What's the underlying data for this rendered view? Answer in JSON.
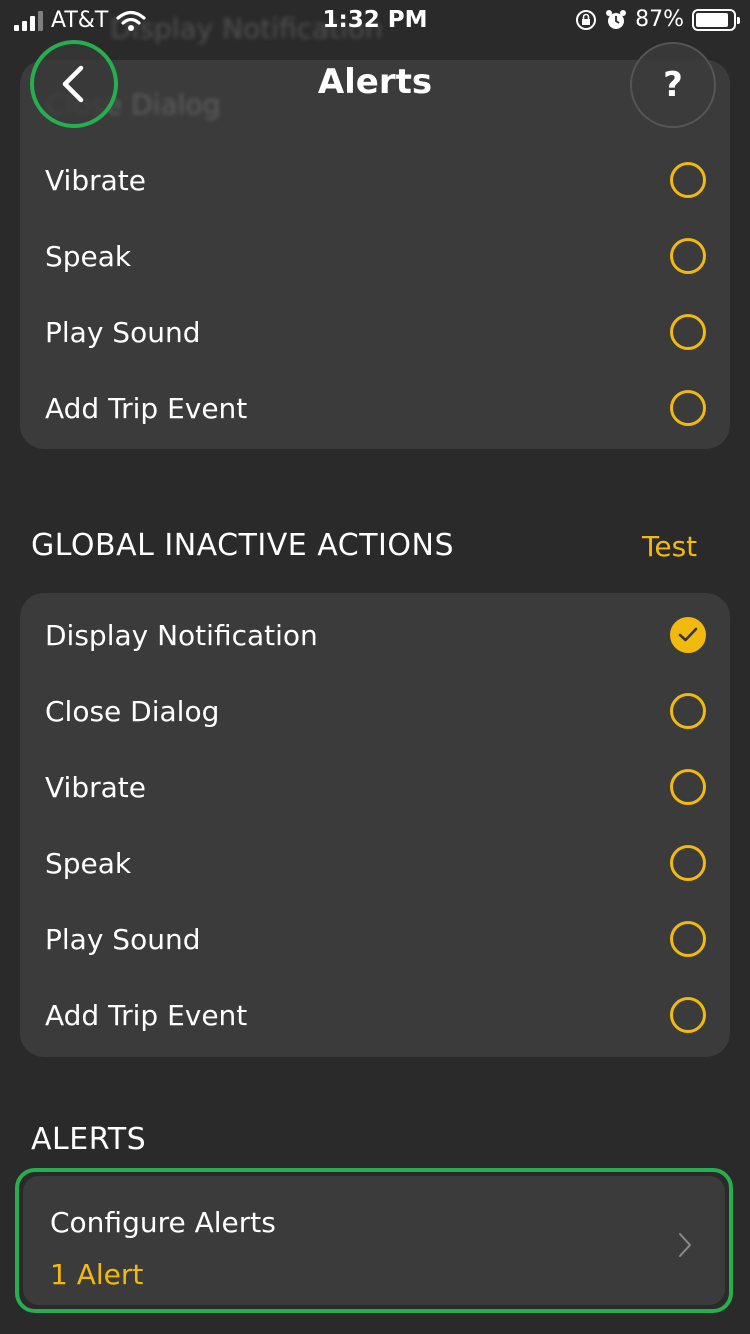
{
  "status_bar": {
    "carrier": "AT&T",
    "time": "1:32 PM",
    "battery": "87%"
  },
  "header": {
    "title": "Alerts",
    "help_label": "?",
    "ghost_line_1": "Display Notification",
    "ghost_line_2": "Close Dialog"
  },
  "global_active_partial": {
    "items": [
      {
        "label": "Vibrate",
        "checked": false
      },
      {
        "label": "Speak",
        "checked": false
      },
      {
        "label": "Play Sound",
        "checked": false
      },
      {
        "label": "Add Trip Event",
        "checked": false
      }
    ]
  },
  "global_inactive": {
    "title": "GLOBAL INACTIVE ACTIONS",
    "test_label": "Test",
    "items": [
      {
        "label": "Display Notification",
        "checked": true
      },
      {
        "label": "Close Dialog",
        "checked": false
      },
      {
        "label": "Vibrate",
        "checked": false
      },
      {
        "label": "Speak",
        "checked": false
      },
      {
        "label": "Play Sound",
        "checked": false
      },
      {
        "label": "Add Trip Event",
        "checked": false
      }
    ]
  },
  "alerts": {
    "title": "ALERTS",
    "configure_label": "Configure Alerts",
    "count_label": "1 Alert"
  },
  "colors": {
    "accent": "#f2b90f",
    "highlight": "#27ae4f",
    "background": "#2a2a2a",
    "card": "#3b3b3b"
  }
}
